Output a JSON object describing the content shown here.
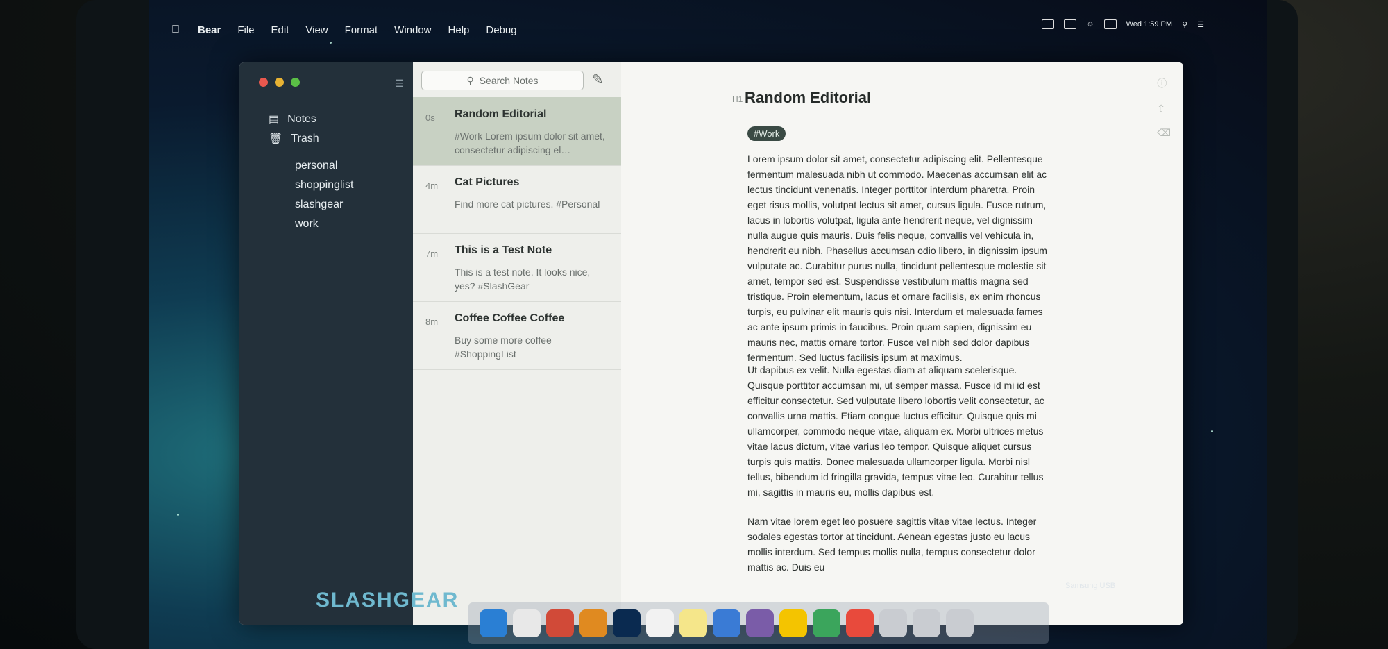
{
  "menubar": {
    "items": [
      "Bear",
      "File",
      "Edit",
      "View",
      "Format",
      "Window",
      "Help",
      "Debug"
    ],
    "clock": "Wed 1:59 PM"
  },
  "sidebar": {
    "items": [
      {
        "label": "Notes",
        "icon": "notes-icon"
      },
      {
        "label": "Trash",
        "icon": "trash-icon"
      }
    ],
    "tags": [
      "personal",
      "shoppinglist",
      "slashgear",
      "work"
    ]
  },
  "notelist": {
    "search_placeholder": "Search Notes",
    "notes": [
      {
        "age": "0s",
        "title": "Random Editorial",
        "snippet": "#Work Lorem ipsum dolor sit amet, consectetur adipiscing el…",
        "selected": true
      },
      {
        "age": "4m",
        "title": "Cat Pictures",
        "snippet": "Find more cat pictures. #Personal"
      },
      {
        "age": "7m",
        "title": "This is a Test Note",
        "snippet": "This is a test note. It looks nice, yes? #SlashGear"
      },
      {
        "age": "8m",
        "title": "Coffee Coffee Coffee",
        "snippet": "Buy some more coffee #ShoppingList"
      }
    ]
  },
  "editor": {
    "heading_marker": "H1",
    "title": "Random Editorial",
    "tag": "#Work",
    "paragraphs": [
      "Lorem ipsum dolor sit amet, consectetur adipiscing elit. Pellentesque fermentum malesuada nibh ut commodo. Maecenas accumsan elit ac lectus tincidunt venenatis. Integer porttitor interdum pharetra. Proin eget risus mollis, volutpat lectus sit amet, cursus ligula. Fusce rutrum, lacus in lobortis volutpat, ligula ante hendrerit neque, vel dignissim nulla augue quis mauris. Duis felis neque, convallis vel vehicula in, hendrerit eu nibh. Phasellus accumsan odio libero, in dignissim ipsum vulputate ac. Curabitur purus nulla, tincidunt pellentesque molestie sit amet, tempor sed est. Suspendisse vestibulum mattis magna sed tristique. Proin elementum, lacus et ornare facilisis, ex enim rhoncus turpis, eu pulvinar elit mauris quis nisi. Interdum et malesuada fames ac ante ipsum primis in faucibus. Proin quam sapien, dignissim eu mauris nec, mattis ornare tortor. Fusce vel nibh sed dolor dapibus fermentum. Sed luctus facilisis ipsum at maximus.",
      "Ut dapibus ex velit. Nulla egestas diam at aliquam scelerisque. Quisque porttitor accumsan mi, ut semper massa. Fusce id mi id est efficitur consectetur. Sed vulputate libero lobortis velit consectetur, ac convallis urna mattis. Etiam congue luctus efficitur. Quisque quis mi ullamcorper, commodo neque vitae, aliquam ex. Morbi ultrices metus vitae lacus dictum, vitae varius leo tempor. Quisque aliquet cursus turpis quis mattis. Donec malesuada ullamcorper ligula. Morbi nisl tellus, bibendum id fringilla gravida, tempus vitae leo. Curabitur tellus mi, sagittis in mauris eu, mollis dapibus est.",
      "Nam vitae lorem eget leo posuere sagittis vitae vitae lectus. Integer sodales egestas tortor at tincidunt. Aenean egestas justo eu lacus mollis interdum. Sed tempus mollis nulla, tempus consectetur dolor mattis ac. Duis eu"
    ]
  },
  "watermark": "SLASHGEAR",
  "usb_label": "Samsung USB",
  "colors": {
    "sidebar": "#23303a",
    "selected_note": "#c8d1c3",
    "tag_pill": "#3a4a44",
    "watermark": "#6fb9cf"
  }
}
